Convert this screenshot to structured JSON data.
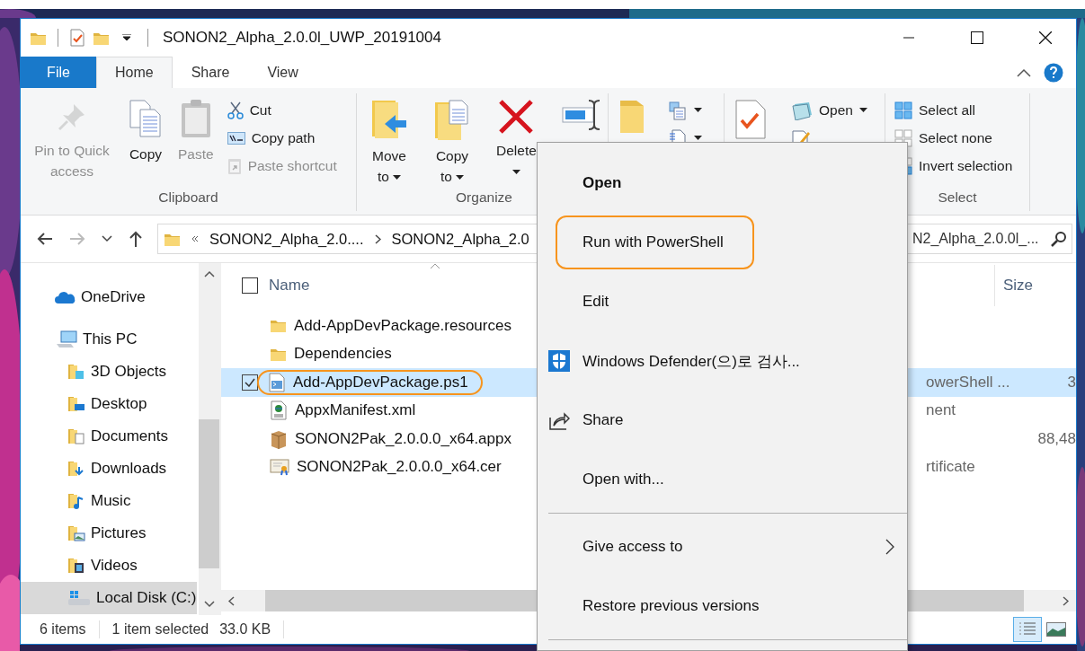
{
  "window": {
    "title": "SONON2_Alpha_2.0.0l_UWP_20191004"
  },
  "ribbon_tabs": [
    {
      "label": "File",
      "kind": "file",
      "selected": false
    },
    {
      "label": "Home",
      "kind": "tab",
      "selected": true
    },
    {
      "label": "Share",
      "kind": "tab",
      "selected": false
    },
    {
      "label": "View",
      "kind": "tab",
      "selected": false
    }
  ],
  "ribbon_groups": [
    {
      "label": "Clipboard",
      "items": [
        {
          "kind": "large",
          "label": "Pin to Quick access",
          "disabled": true
        },
        {
          "kind": "large",
          "label": "Copy",
          "disabled": false
        },
        {
          "kind": "large",
          "label": "Paste",
          "disabled": true
        },
        {
          "kind": "small",
          "label": "Cut",
          "disabled": false
        },
        {
          "kind": "small",
          "label": "Copy path",
          "disabled": false
        },
        {
          "kind": "small",
          "label": "Paste shortcut",
          "disabled": true
        }
      ]
    },
    {
      "label": "Organize",
      "items": [
        {
          "kind": "large",
          "label": "Move to",
          "dropdown": true,
          "disabled": false
        },
        {
          "kind": "large",
          "label": "Copy to",
          "dropdown": true,
          "disabled": false
        },
        {
          "kind": "large",
          "label": "Delete",
          "dropdown": true,
          "disabled": false
        },
        {
          "kind": "large",
          "dropdown": false,
          "disabled": false
        }
      ]
    },
    {
      "items": [
        {
          "kind": "large",
          "dropdown": false,
          "disabled": false
        },
        {
          "kind": "small",
          "dropdown": true,
          "disabled": false
        },
        {
          "kind": "small",
          "dropdown": true,
          "disabled": false
        }
      ]
    },
    {
      "items": [
        {
          "kind": "large",
          "dropdown": false,
          "disabled": false
        },
        {
          "kind": "small",
          "label": "Open",
          "dropdown": true,
          "disabled": false
        },
        {
          "kind": "small",
          "dropdown": false,
          "disabled": false
        }
      ]
    },
    {
      "label": "Select",
      "items": [
        {
          "kind": "small",
          "label": "Select all",
          "disabled": false
        },
        {
          "kind": "small",
          "label": "Select none",
          "disabled": false
        },
        {
          "kind": "small",
          "label": "Invert selection",
          "disabled": false
        }
      ]
    }
  ],
  "address_bar": {
    "crumbs": [
      "SONON2_Alpha_2.0....",
      "SONON2_Alpha_2.0"
    ]
  },
  "search": {
    "placeholder": "N2_Alpha_2.0.0l_..."
  },
  "navigation": [
    {
      "label": "OneDrive",
      "selected": false
    },
    {
      "label": "This PC",
      "selected": false,
      "children": [
        {
          "label": "3D Objects",
          "selected": false
        },
        {
          "label": "Desktop",
          "selected": false
        },
        {
          "label": "Documents",
          "selected": false
        },
        {
          "label": "Downloads",
          "selected": false
        },
        {
          "label": "Music",
          "selected": false
        },
        {
          "label": "Pictures",
          "selected": false
        },
        {
          "label": "Videos",
          "selected": false
        },
        {
          "label": "Local Disk (C:)",
          "selected": true
        }
      ]
    }
  ],
  "file_list": {
    "columns": [
      "Name",
      "Size"
    ],
    "all_checked": false,
    "files": [
      {
        "name": "Add-AppDevPackage.resources",
        "kind": "folder",
        "selected": false,
        "highlighted": false
      },
      {
        "name": "Dependencies",
        "kind": "folder",
        "selected": false,
        "highlighted": false
      },
      {
        "name": "Add-AppDevPackage.ps1",
        "kind": "script",
        "selected": true,
        "highlighted": true,
        "type": "owerShell ...",
        "size": "3"
      },
      {
        "name": "AppxManifest.xml",
        "kind": "xml",
        "selected": false,
        "highlighted": false,
        "type": "nent"
      },
      {
        "name": "SONON2Pak_2.0.0.0_x64.appx",
        "kind": "package",
        "selected": false,
        "highlighted": false,
        "size": "88,48"
      },
      {
        "name": "SONON2Pak_2.0.0.0_x64.cer",
        "kind": "certificate",
        "selected": false,
        "highlighted": false,
        "type": "rtificate"
      }
    ]
  },
  "context_menu": {
    "items": [
      {
        "kind": "item",
        "label": "Open",
        "default": true,
        "highlighted": false
      },
      {
        "kind": "item",
        "label": "Run with PowerShell",
        "default": false,
        "highlighted": true
      },
      {
        "kind": "item",
        "label": "Edit",
        "default": false,
        "highlighted": false
      },
      {
        "kind": "item",
        "label": "Windows Defender(으)로 검사...",
        "default": false,
        "highlighted": false
      },
      {
        "kind": "item",
        "label": "Share",
        "default": false,
        "highlighted": false
      },
      {
        "kind": "item",
        "label": "Open with...",
        "default": false,
        "highlighted": false
      },
      {
        "kind": "separator"
      },
      {
        "kind": "submenu",
        "label": "Give access to",
        "default": false,
        "highlighted": false
      },
      {
        "kind": "item",
        "label": "Restore previous versions",
        "default": false,
        "highlighted": false
      },
      {
        "kind": "separator"
      }
    ]
  },
  "status_bar": {
    "count": "6 items",
    "selection": "1 item selected",
    "size": "33.0 KB"
  },
  "views": [
    {
      "kind": "details",
      "selected": true
    },
    {
      "kind": "large_icons",
      "selected": false
    }
  ]
}
